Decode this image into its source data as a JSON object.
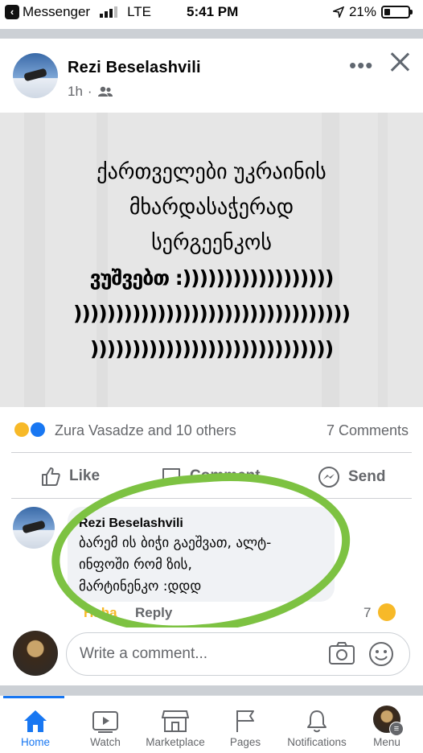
{
  "status_bar": {
    "back_app": "Messenger",
    "carrier": "LTE",
    "time": "5:41 PM",
    "battery": "21%"
  },
  "post": {
    "author": "Rezi Beselashvili",
    "time": "1h",
    "audience_icon": "friends-icon",
    "text_lines": [
      "ქართველები უკრაინის",
      "მხარდასაჭერად",
      "სერგეენკოს",
      "ვუშვებთ :))))))))))))))))))",
      ")))))))))))))))))))))))))))))))))",
      ")))))))))))))))))))))))))))))"
    ],
    "reactions_text": "Zura Vasadze and 10 others",
    "comments_count": "7 Comments",
    "actions": {
      "like": "Like",
      "comment": "Comment",
      "send": "Send"
    }
  },
  "comment": {
    "author": "Rezi Beselashvili",
    "text_lines": [
      "ბარემ ის ბიჭი გაეშვათ, ალტ-",
      "ინფოში რომ ზის,",
      "მარტინენკო :დდდ"
    ],
    "haha_label": "Haha",
    "reply_label": "Reply",
    "reaction_count": "7"
  },
  "composer": {
    "placeholder": "Write a comment..."
  },
  "tabs": [
    {
      "label": "Home",
      "icon": "home-icon",
      "active": true
    },
    {
      "label": "Watch",
      "icon": "watch-icon",
      "active": false
    },
    {
      "label": "Marketplace",
      "icon": "marketplace-icon",
      "active": false
    },
    {
      "label": "Pages",
      "icon": "pages-flag-icon",
      "active": false
    },
    {
      "label": "Notifications",
      "icon": "bell-icon",
      "active": false
    },
    {
      "label": "Menu",
      "icon": "menu-avatar-icon",
      "active": false
    }
  ],
  "colors": {
    "accent": "#1877f2",
    "highlight_ring": "#7dc242",
    "muted": "#65676b"
  }
}
